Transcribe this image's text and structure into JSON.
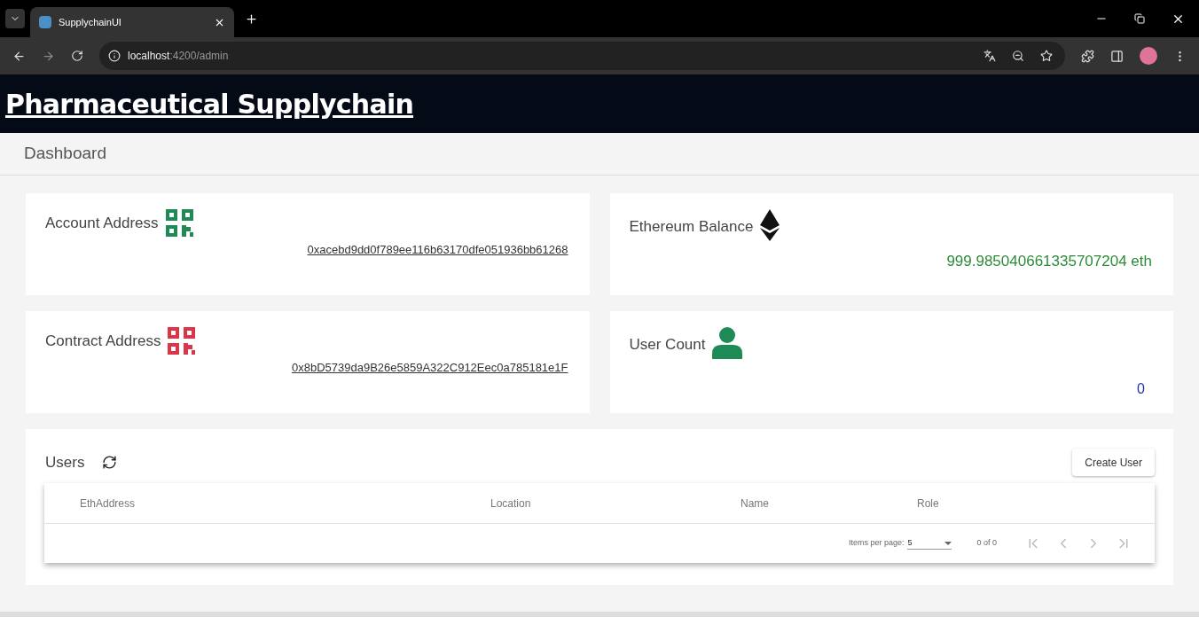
{
  "browser": {
    "tab_title": "SupplychainUI",
    "url_host": "localhost",
    "url_path": ":4200/admin"
  },
  "header": {
    "title": "Pharmaceutical Supplychain"
  },
  "breadcrumb": "Dashboard",
  "cards": [
    {
      "kind": "account",
      "label": "Account Address",
      "value": "0xacebd9dd0f789ee116b63170dfe051936bb61268"
    },
    {
      "kind": "balance",
      "label": "Ethereum Balance",
      "value": "999.985040661335707204 eth"
    },
    {
      "kind": "contract",
      "label": "Contract Address",
      "value": "0x8bD5739da9B26e5859A322C912Eec0a785181e1F"
    },
    {
      "kind": "users",
      "label": "User Count",
      "value": "0"
    }
  ],
  "users": {
    "title": "Users",
    "create_button": "Create User",
    "columns": [
      "EthAddress",
      "Location",
      "Name",
      "Role"
    ],
    "paginator": {
      "items_label": "Items per page:",
      "page_size": "5",
      "range": "0 of 0",
      "buttons": [
        {
          "kind": "first",
          "disabled": true
        },
        {
          "kind": "prev",
          "disabled": true
        },
        {
          "kind": "next",
          "disabled": true
        },
        {
          "kind": "last",
          "disabled": true
        }
      ]
    }
  }
}
